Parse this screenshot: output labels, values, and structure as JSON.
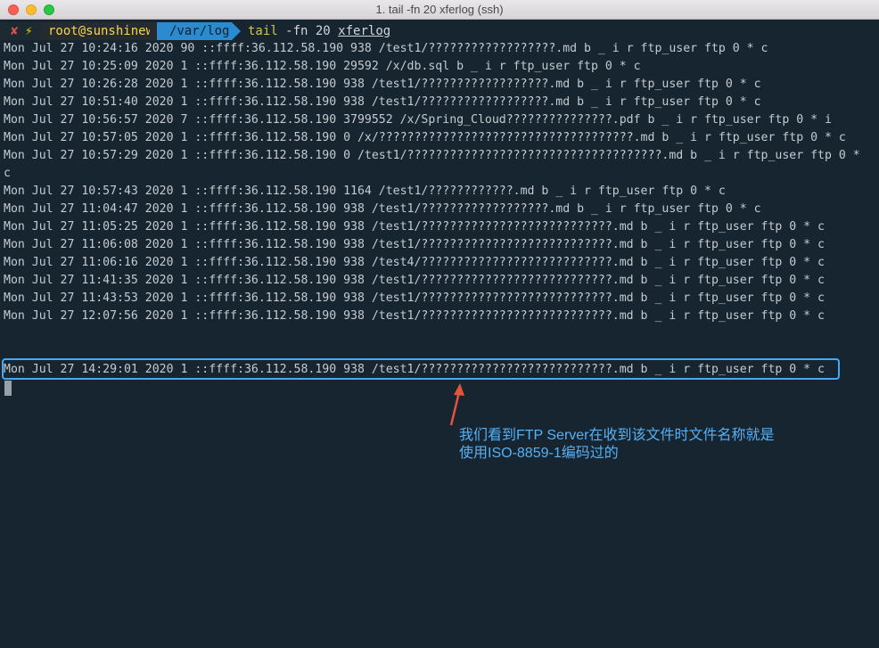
{
  "window": {
    "title": "1. tail -fn 20 xferlog (ssh)"
  },
  "prompt": {
    "status_x": "✘",
    "status_bolt": "⚡",
    "user": "root@sunshinew",
    "dir": "/var/log",
    "command": "tail",
    "flags": "-fn 20",
    "file": "xferlog"
  },
  "log_lines": [
    "Mon Jul 27 10:24:16 2020 90 ::ffff:36.112.58.190 938 /test1/??????????????????.md b _ i r ftp_user ftp 0 * c",
    "Mon Jul 27 10:25:09 2020 1 ::ffff:36.112.58.190 29592 /x/db.sql b _ i r ftp_user ftp 0 * c",
    "Mon Jul 27 10:26:28 2020 1 ::ffff:36.112.58.190 938 /test1/??????????????????.md b _ i r ftp_user ftp 0 * c",
    "Mon Jul 27 10:51:40 2020 1 ::ffff:36.112.58.190 938 /test1/??????????????????.md b _ i r ftp_user ftp 0 * c",
    "Mon Jul 27 10:56:57 2020 7 ::ffff:36.112.58.190 3799552 /x/Spring_Cloud???????????????.pdf b _ i r ftp_user ftp 0 * i",
    "Mon Jul 27 10:57:05 2020 1 ::ffff:36.112.58.190 0 /x/????????????????????????????????????.md b _ i r ftp_user ftp 0 * c",
    "Mon Jul 27 10:57:29 2020 1 ::ffff:36.112.58.190 0 /test1/????????????????????????????????????.md b _ i r ftp_user ftp 0 *",
    "c",
    "Mon Jul 27 10:57:43 2020 1 ::ffff:36.112.58.190 1164 /test1/????????????.md b _ i r ftp_user ftp 0 * c",
    "Mon Jul 27 11:04:47 2020 1 ::ffff:36.112.58.190 938 /test1/??????????????????.md b _ i r ftp_user ftp 0 * c",
    "Mon Jul 27 11:05:25 2020 1 ::ffff:36.112.58.190 938 /test1/???????????????????????????.md b _ i r ftp_user ftp 0 * c",
    "Mon Jul 27 11:06:08 2020 1 ::ffff:36.112.58.190 938 /test1/???????????????????????????.md b _ i r ftp_user ftp 0 * c",
    "Mon Jul 27 11:06:16 2020 1 ::ffff:36.112.58.190 938 /test4/???????????????????????????.md b _ i r ftp_user ftp 0 * c",
    "Mon Jul 27 11:41:35 2020 1 ::ffff:36.112.58.190 938 /test1/???????????????????????????.md b _ i r ftp_user ftp 0 * c",
    "Mon Jul 27 11:43:53 2020 1 ::ffff:36.112.58.190 938 /test1/???????????????????????????.md b _ i r ftp_user ftp 0 * c",
    "Mon Jul 27 12:07:56 2020 1 ::ffff:36.112.58.190 938 /test1/???????????????????????????.md b _ i r ftp_user ftp 0 * c"
  ],
  "highlighted_line": "Mon Jul 27 14:29:01 2020 1 ::ffff:36.112.58.190 938 /test1/???????????????????????????.md b _ i r ftp_user ftp 0 * c",
  "annotation": {
    "line1": "我们看到FTP Server在收到该文件时文件名称就是",
    "line2": "使用ISO-8859-1编码过的",
    "color": "#57b0f5"
  }
}
